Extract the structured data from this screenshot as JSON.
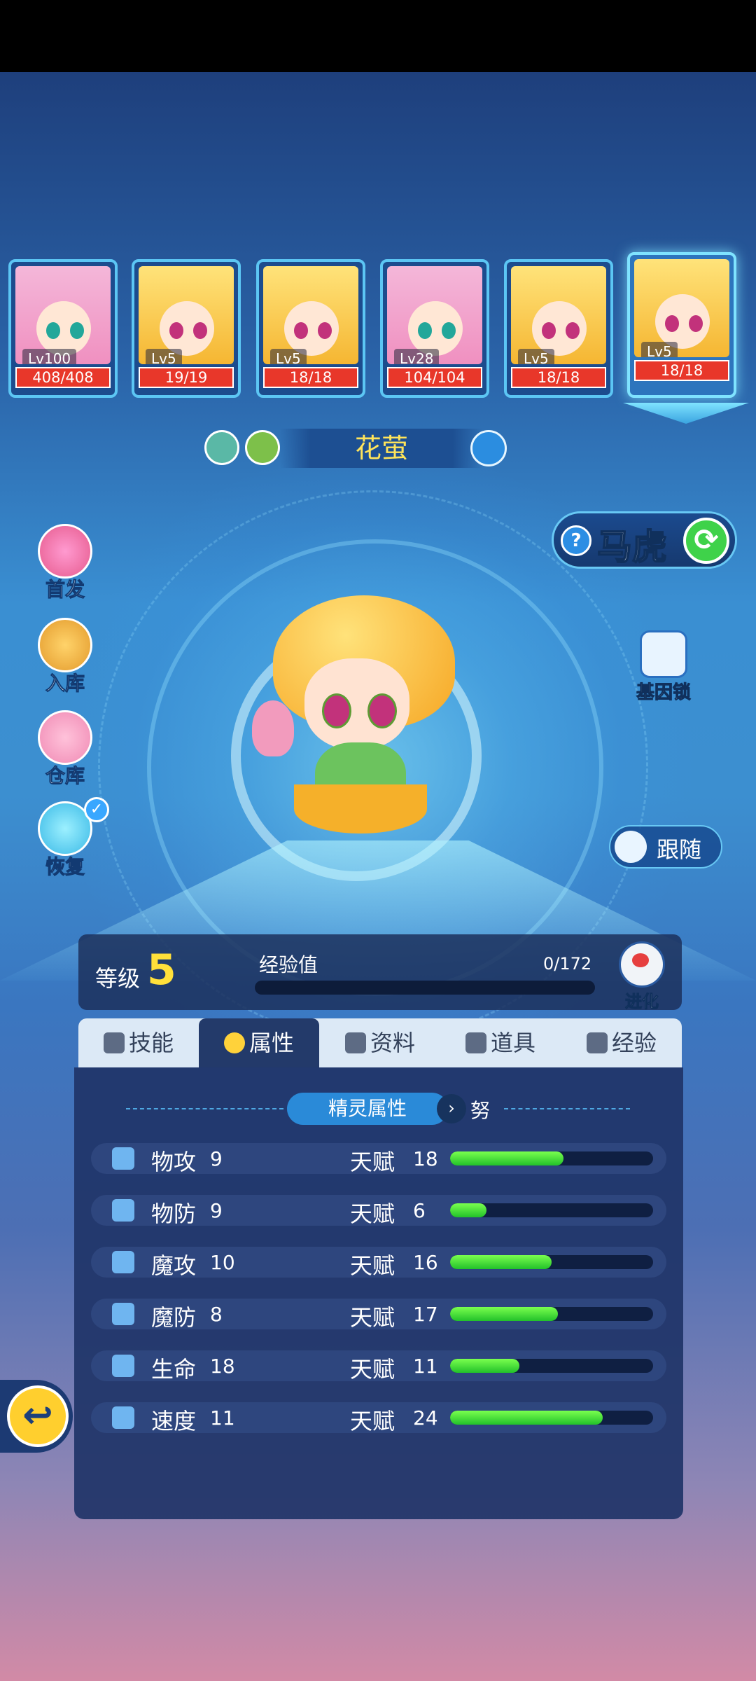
{
  "roster": [
    {
      "type": "pink",
      "level": "Lv100",
      "hp": "408/408"
    },
    {
      "type": "yellow",
      "level": "Lv5",
      "hp": "19/19"
    },
    {
      "type": "yellow",
      "level": "Lv5",
      "hp": "18/18"
    },
    {
      "type": "pink",
      "level": "Lv28",
      "hp": "104/104"
    },
    {
      "type": "yellow",
      "level": "Lv5",
      "hp": "18/18"
    },
    {
      "type": "yellow",
      "level": "Lv5",
      "hp": "18/18",
      "selected": true
    }
  ],
  "pet": {
    "name": "花萤",
    "attr_icons": [
      "grass-wind-icon",
      "grass-leaf-icon"
    ]
  },
  "right": {
    "nature": "马虎",
    "gene_lock": "基因锁",
    "follow": "跟随"
  },
  "left_buttons": [
    {
      "label": "首发",
      "icon": "starter-icon"
    },
    {
      "label": "入库",
      "icon": "deposit-icon"
    },
    {
      "label": "仓库",
      "icon": "warehouse-icon"
    },
    {
      "label": "恢复",
      "icon": "restore-icon"
    }
  ],
  "level": {
    "label": "等级",
    "value": "5",
    "exp_label": "经验值",
    "exp_value": "0/172",
    "exp_progress": 0,
    "evolve": "进化"
  },
  "tabs": [
    "技能",
    "属性",
    "资料",
    "道具",
    "经验"
  ],
  "active_tab": "属性",
  "panel": {
    "title": "精灵属性",
    "more": "努"
  },
  "stats": [
    {
      "name": "物攻",
      "value": "9",
      "talent_label": "天赋",
      "talent": "18",
      "ratio": 0.56
    },
    {
      "name": "物防",
      "value": "9",
      "talent_label": "天赋",
      "talent": "6",
      "ratio": 0.18
    },
    {
      "name": "魔攻",
      "value": "10",
      "talent_label": "天赋",
      "talent": "16",
      "ratio": 0.5
    },
    {
      "name": "魔防",
      "value": "8",
      "talent_label": "天赋",
      "talent": "17",
      "ratio": 0.53
    },
    {
      "name": "生命",
      "value": "18",
      "talent_label": "天赋",
      "talent": "11",
      "ratio": 0.34
    },
    {
      "name": "速度",
      "value": "11",
      "talent_label": "天赋",
      "talent": "24",
      "ratio": 0.75
    }
  ],
  "colors": {
    "hp_bar": "#e8372a",
    "level_number": "#ffe03a",
    "talent_bar": "#22c12a",
    "name": "#ffe45a"
  }
}
